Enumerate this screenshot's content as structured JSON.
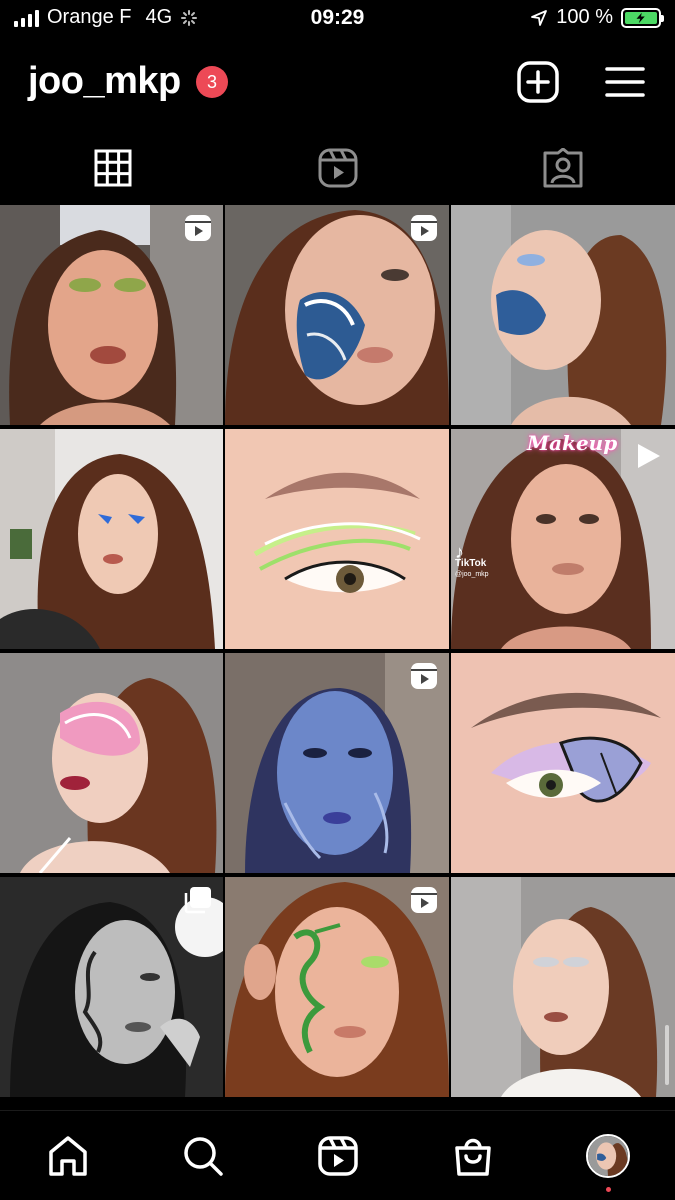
{
  "status_bar": {
    "carrier": "Orange F",
    "network": "4G",
    "time": "09:29",
    "battery": "100 %",
    "battery_level": 1.0
  },
  "profile": {
    "username": "joo_mkp",
    "notification_count": "3"
  },
  "tabs": [
    {
      "name": "posts-grid",
      "icon": "grid-icon",
      "active": true
    },
    {
      "name": "reels",
      "icon": "reels-icon",
      "active": false
    },
    {
      "name": "tagged",
      "icon": "tagged-person-icon",
      "active": false
    }
  ],
  "posts": [
    {
      "type": "reel",
      "label": ""
    },
    {
      "type": "reel",
      "label": ""
    },
    {
      "type": "photo",
      "label": ""
    },
    {
      "type": "photo",
      "label": ""
    },
    {
      "type": "photo",
      "label": ""
    },
    {
      "type": "video",
      "label": "Makeup",
      "watermark": "TikTok",
      "watermark_handle": "@joo_mkp"
    },
    {
      "type": "photo",
      "label": ""
    },
    {
      "type": "reel",
      "label": ""
    },
    {
      "type": "photo",
      "label": ""
    },
    {
      "type": "carousel",
      "label": ""
    },
    {
      "type": "reel",
      "label": ""
    },
    {
      "type": "photo",
      "label": ""
    }
  ],
  "bottom_nav": [
    {
      "name": "home",
      "icon": "home-icon"
    },
    {
      "name": "search",
      "icon": "search-icon"
    },
    {
      "name": "reels",
      "icon": "reels-icon"
    },
    {
      "name": "shop",
      "icon": "shopping-bag-icon"
    },
    {
      "name": "profile",
      "icon": "avatar",
      "active": true
    }
  ],
  "colors": {
    "background": "#000000",
    "badge": "#ed4956",
    "battery_fill": "#4cd964",
    "label_glow": "#ff4fb2"
  }
}
